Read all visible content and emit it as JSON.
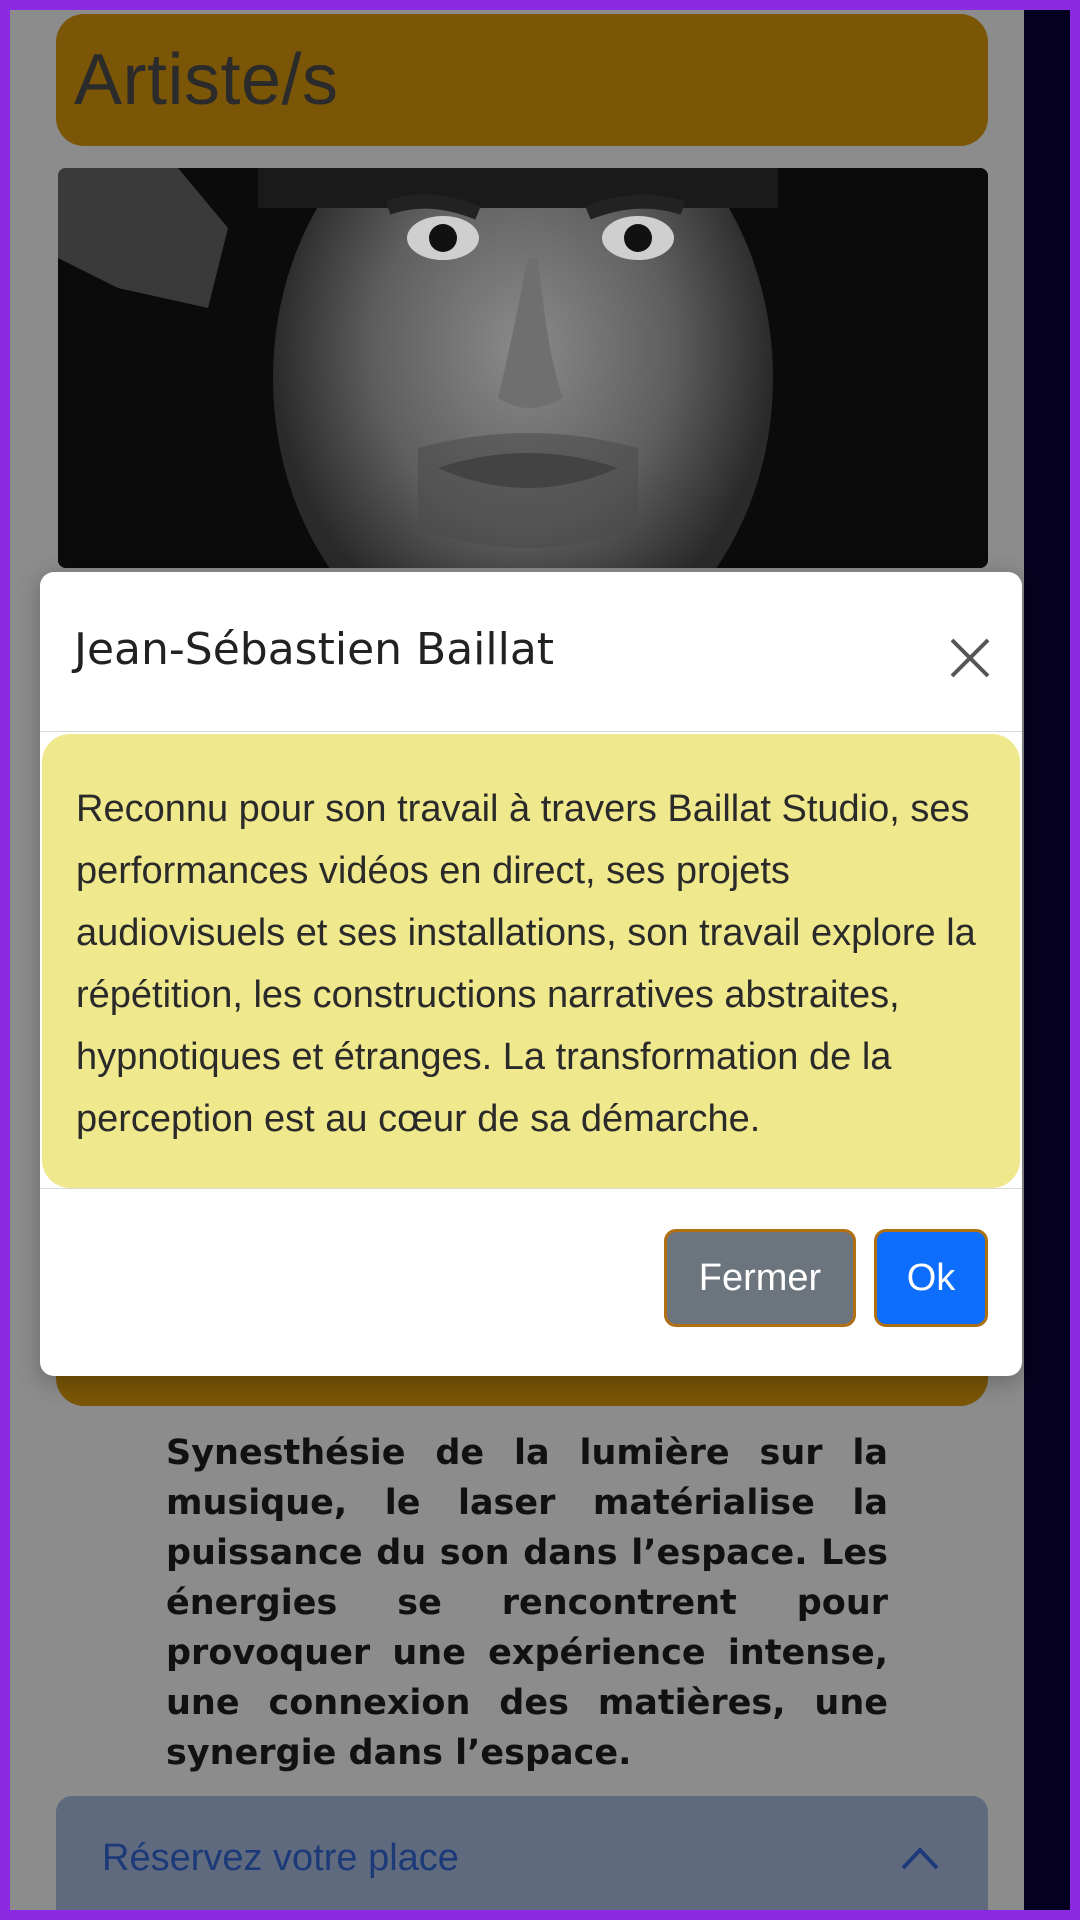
{
  "page": {
    "artists_heading": "Artiste/s",
    "event_description": "Synesthésie de la lumière sur la musique, le laser matérialise la puissance du son dans l’espace. Les énergies se rencontrent pour provoquer une expérience intense, une connexion des matières, une synergie dans l’espace.",
    "reserve_label": "Réservez votre place"
  },
  "modal": {
    "title": "Jean-Sébastien Baillat",
    "body": "Reconnu pour son travail à travers Baillat Studio, ses performances vidéos en direct, ses projets audiovisuels et ses installations, son travail explore la répétition, les constructions narratives abstraites, hypnotiques et étranges. La transformation de la perception est au cœur de sa démarche.",
    "close_label": "Fermer",
    "ok_label": "Ok"
  },
  "icons": {
    "close": "close-icon",
    "chevron": "chevron-up-icon"
  },
  "colors": {
    "frame_border": "#8a2be2",
    "heading_bg": "#7a5606",
    "modal_body_bg": "#f0e88c",
    "close_button_bg": "#6c757d",
    "ok_button_bg": "#0d6efd",
    "reserve_bg": "#5f6a7e"
  }
}
